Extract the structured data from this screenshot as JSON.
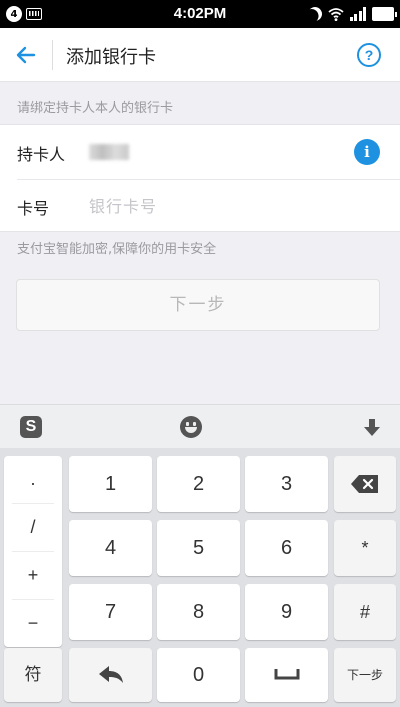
{
  "status_bar": {
    "notification_count": "4",
    "time": "4:02PM"
  },
  "app_bar": {
    "title": "添加银行卡",
    "help_label": "?"
  },
  "form": {
    "section_hint": "请绑定持卡人本人的银行卡",
    "holder_label": "持卡人",
    "info_label": "i",
    "card_label": "卡号",
    "card_placeholder": "银行卡号",
    "card_value": ""
  },
  "security_hint": "支付宝智能加密,保障你的用卡安全",
  "next_button": "下一步",
  "keyboard": {
    "toolbar": {
      "logo_label": "S"
    },
    "symbols": [
      ".",
      "/",
      "+",
      "−"
    ],
    "digits": [
      "1",
      "2",
      "3",
      "4",
      "5",
      "6",
      "7",
      "8",
      "9",
      "0"
    ],
    "right_keys": [
      "*",
      "#"
    ],
    "bottom_left": "符",
    "enter_label": "下一步"
  },
  "colors": {
    "accent": "#1e92e0",
    "background": "#efeff4",
    "keyboard_bg": "#dfe0e4"
  },
  "icons": {
    "back": "arrow-left-icon",
    "help": "question-circle-icon",
    "info": "info-circle-icon",
    "delete": "backspace-icon",
    "space": "space-icon",
    "return": "return-arrow-icon",
    "hide_keyboard": "arrow-down-icon",
    "emoji": "smiley-icon"
  }
}
